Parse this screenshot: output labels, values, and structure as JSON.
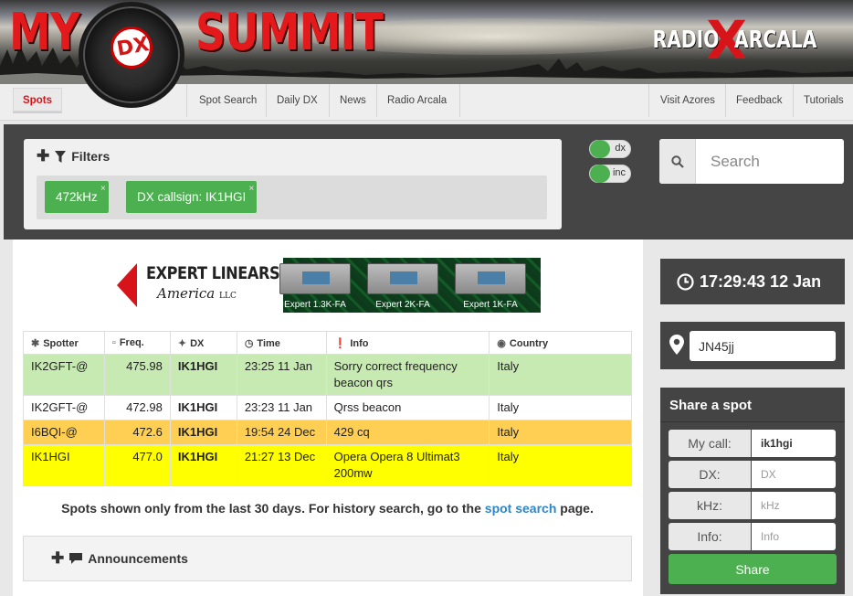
{
  "logo": {
    "left_word": "MY",
    "dial_text": "DX",
    "right_word": "SUMMIT"
  },
  "partner_logo": {
    "part1": "RADIO",
    "x": "X",
    "part2": "ARCALA"
  },
  "nav": {
    "active": "Spots",
    "left_items": [
      "Spot Search",
      "Daily DX",
      "News",
      "Radio Arcala"
    ],
    "right_items": [
      "Visit Azores",
      "Feedback",
      "Tutorials"
    ]
  },
  "filters": {
    "title": "Filters",
    "chips": [
      {
        "label": "472kHz",
        "remove": "×"
      },
      {
        "label": "DX callsign: IK1HGI",
        "remove": "×"
      }
    ]
  },
  "toggles": {
    "dx": "dx",
    "inc": "inc"
  },
  "search": {
    "placeholder": "Search"
  },
  "ad": {
    "brand_line1": "EXPERT LINEARS",
    "brand_line2": "America",
    "brand_suffix": "LLC",
    "models": [
      "Expert 1.3K-FA",
      "Expert 2K-FA",
      "Expert 1K-FA"
    ]
  },
  "table": {
    "headers": [
      "Spotter",
      "Freq.",
      "DX",
      "Time",
      "Info",
      "Country"
    ],
    "header_icons": [
      "antenna-icon",
      "signal-bars-icon",
      "satellite-icon",
      "clock-icon",
      "exclamation-icon",
      "globe-icon"
    ],
    "rows": [
      {
        "spotter": "IK2GFT-@",
        "freq": "475.98",
        "dx": "IK1HGI",
        "time": "23:25 11 Jan",
        "info": "Sorry correct frequency beacon qrs",
        "country": "Italy",
        "color": "#c7eab2"
      },
      {
        "spotter": "IK2GFT-@",
        "freq": "472.98",
        "dx": "IK1HGI",
        "time": "23:23 11 Jan",
        "info": "Qrss beacon",
        "country": "Italy",
        "color": "#ffffff"
      },
      {
        "spotter": "I6BQI-@",
        "freq": "472.6",
        "dx": "IK1HGI",
        "time": "19:54 24 Dec",
        "info": "429 cq",
        "country": "Italy",
        "color": "#ffcf53"
      },
      {
        "spotter": "IK1HGI",
        "freq": "477.0",
        "dx": "IK1HGI",
        "time": "21:27 13 Dec",
        "info": "Opera Opera 8 Ultimat3 200mw",
        "country": "Italy",
        "color": "#ffff00"
      }
    ]
  },
  "note": {
    "prefix": "Spots shown only from the last 30 days. For history search, go to the",
    "link": "spot search",
    "suffix": "page."
  },
  "announcements": {
    "title": "Announcements"
  },
  "clock": {
    "value": "17:29:43 12 Jan"
  },
  "locator": {
    "value": "JN45jj"
  },
  "share": {
    "title": "Share a spot",
    "my_call_label": "My call:",
    "my_call_value": "ik1hgi",
    "dx_label": "DX:",
    "dx_placeholder": "DX",
    "khz_label": "kHz:",
    "khz_placeholder": "kHz",
    "info_label": "Info:",
    "info_placeholder": "Info",
    "button": "Share"
  },
  "colors": {
    "brand_red": "#d8141b",
    "green": "#4cb050",
    "dark_panel": "#454545",
    "link_blue": "#2e86c9"
  }
}
